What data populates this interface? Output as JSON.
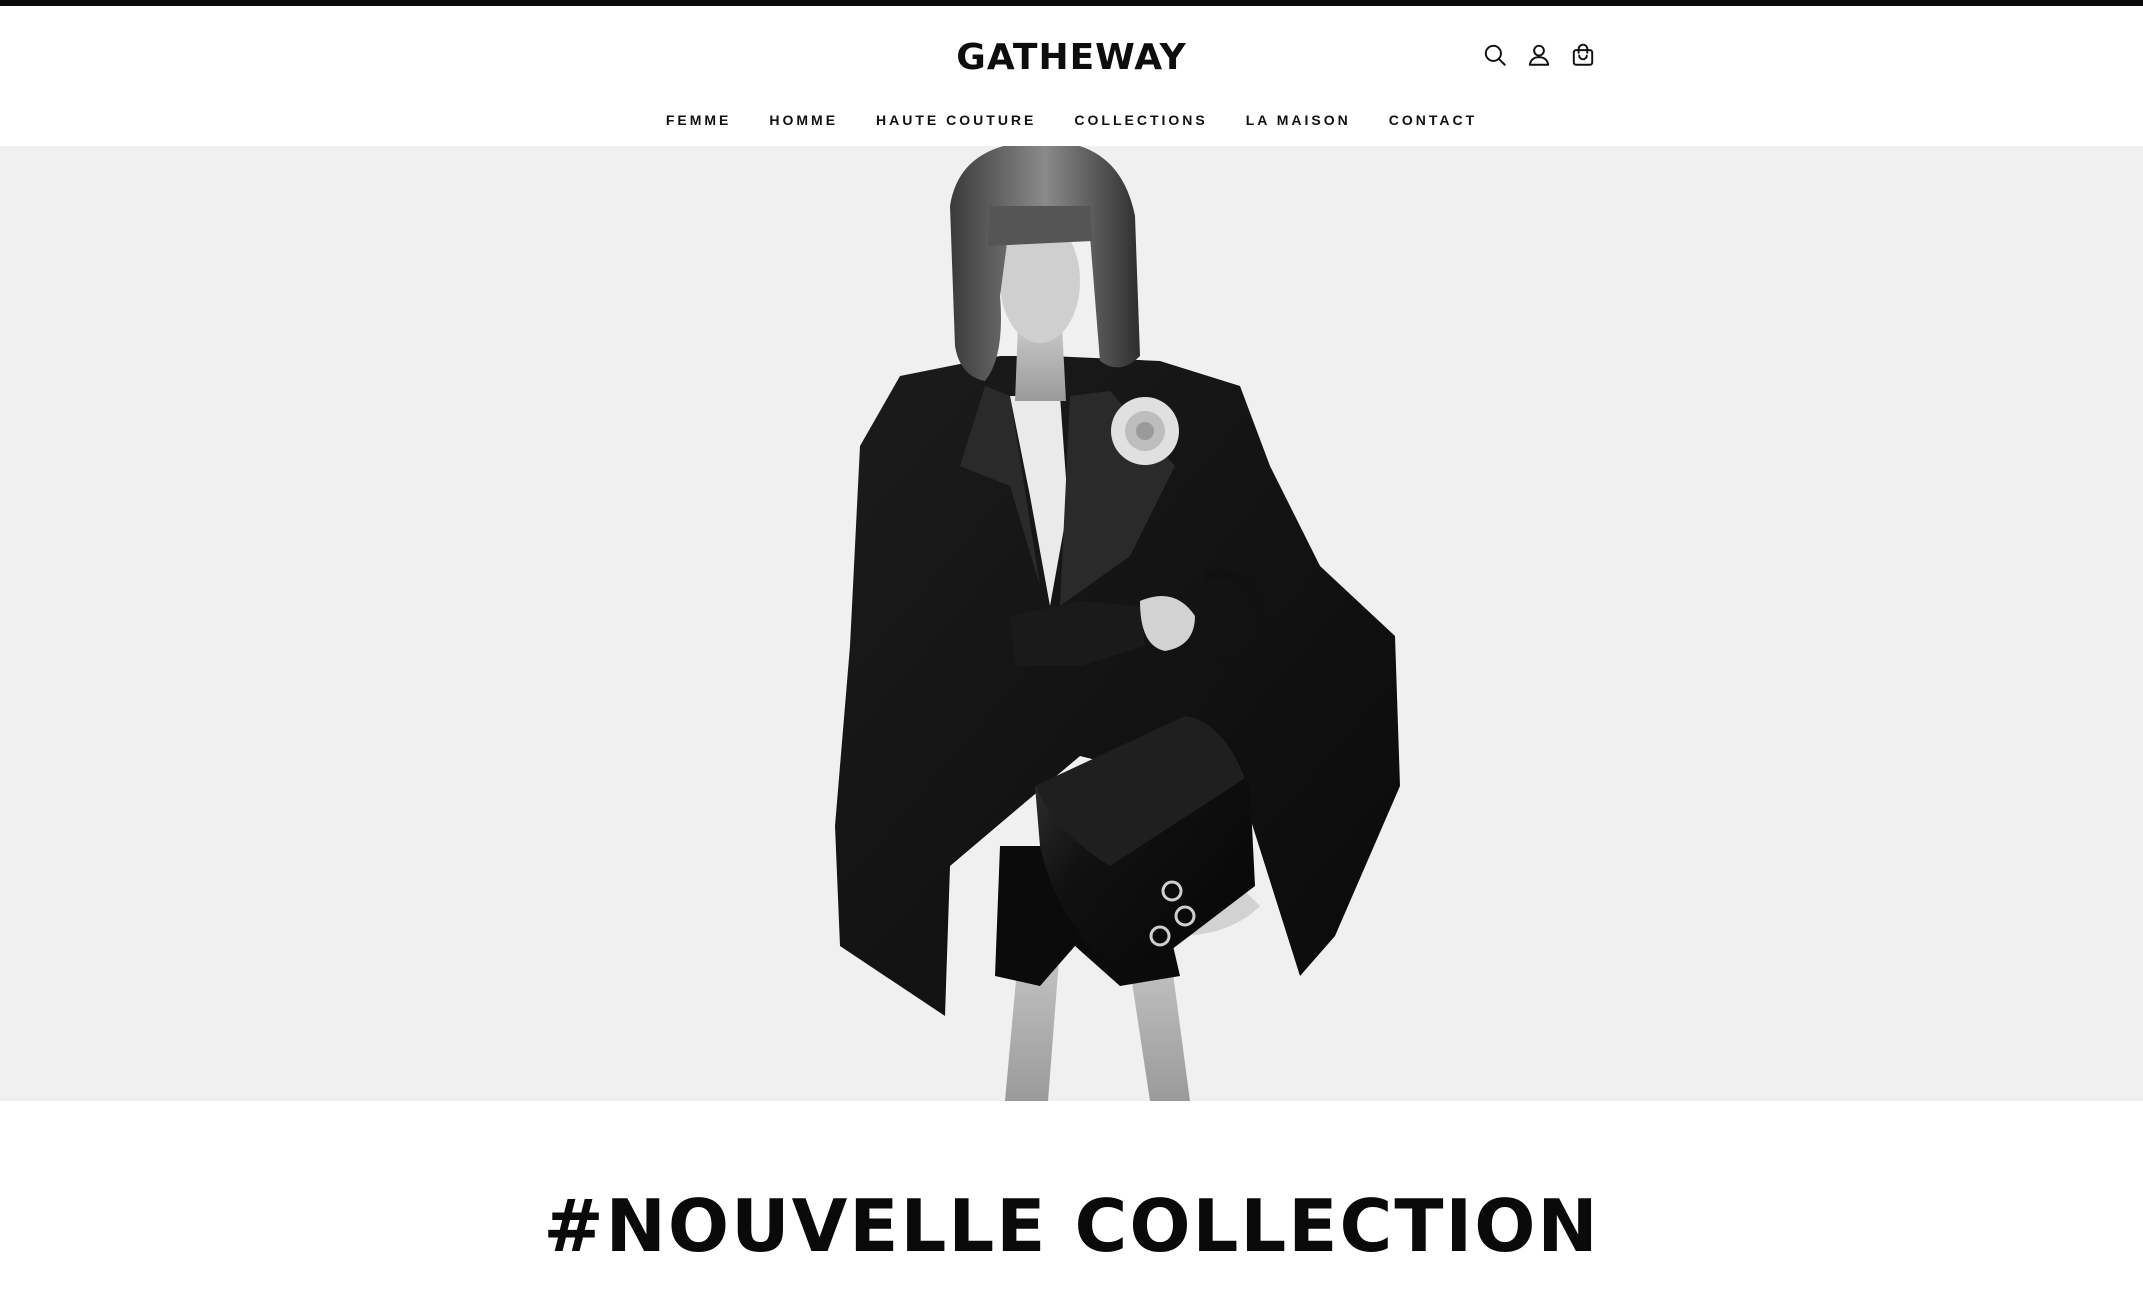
{
  "brand": {
    "name": "GATHEWAY"
  },
  "header": {
    "icons": [
      {
        "name": "search-icon"
      },
      {
        "name": "account-icon"
      },
      {
        "name": "shopping-bag-icon"
      }
    ]
  },
  "nav": {
    "items": [
      {
        "label": "FEMME"
      },
      {
        "label": "HOMME"
      },
      {
        "label": "HAUTE COUTURE"
      },
      {
        "label": "COLLECTIONS"
      },
      {
        "label": "LA MAISON"
      },
      {
        "label": "CONTACT"
      }
    ]
  },
  "hero": {
    "image": "black-and-white fashion photo of model in tuxedo blazer holding leather handbag",
    "background_color": "#f0f0f0"
  },
  "headline": {
    "text": "#NOUVELLE COLLECTION"
  },
  "colors": {
    "text": "#111111",
    "top_strip": "#0a0a0a",
    "hero_bg": "#f0f0f0"
  }
}
